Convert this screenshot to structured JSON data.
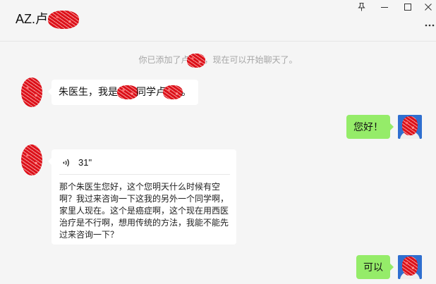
{
  "header": {
    "title": "AZ.卢"
  },
  "system_notice": {
    "prefix": "你已添加了卢",
    "suffix": "，现在可以开始聊天了。"
  },
  "messages": {
    "incoming_1": {
      "part_1": "朱医生，我是",
      "part_2": "同学卢",
      "part_3": "。"
    },
    "outgoing_1": {
      "text": "您好！"
    },
    "incoming_voice": {
      "duration": "31\"",
      "transcript": "那个朱医生您好，这个您明天什么时候有空啊？我过来咨询一下这我的另外一个同学啊，家里人现在。这个是癌症啊，这个现在用西医治疗是不行啊，想用传统的方法，我能不能先过来咨询一下？"
    },
    "outgoing_2": {
      "text": "可以"
    }
  },
  "icons": {
    "pin": "pin-icon",
    "minimize": "minimize-icon",
    "maximize": "maximize-icon",
    "close": "close-icon",
    "more": "more-options-icon",
    "voice": "voice-wave-icon"
  },
  "colors": {
    "background": "#f5f5f5",
    "incoming_bubble": "#ffffff",
    "outgoing_bubble": "#95ec69",
    "redaction": "#e4121b"
  }
}
